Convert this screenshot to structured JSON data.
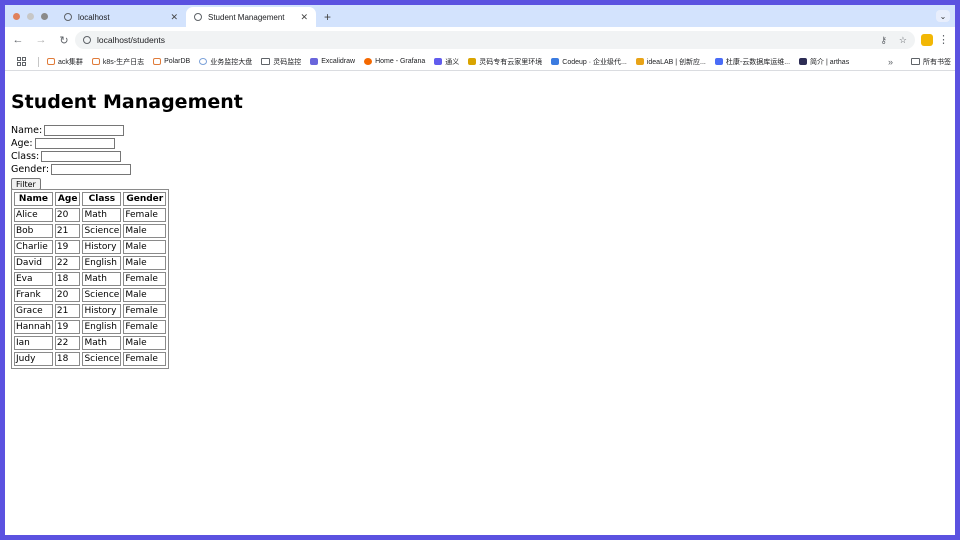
{
  "browser": {
    "tabs": [
      {
        "title": "localhost",
        "active": false
      },
      {
        "title": "Student Management",
        "active": true
      }
    ],
    "new_tab_glyph": "+",
    "url": "localhost/students",
    "bookmarks": [
      {
        "label": "ack集群",
        "icon": "bracket-icon"
      },
      {
        "label": "k8s-生产日志",
        "icon": "bracket-icon"
      },
      {
        "label": "PolarDB",
        "icon": "bracket-icon"
      },
      {
        "label": "业务监控大盘",
        "icon": "gear-icon"
      },
      {
        "label": "灵码监控",
        "icon": "folder-icon"
      },
      {
        "label": "Excalidraw",
        "icon": "tools-icon"
      },
      {
        "label": "Home - Grafana",
        "icon": "grafana-icon"
      },
      {
        "label": "通义",
        "icon": "tongyi-icon"
      },
      {
        "label": "灵码专有云家里环境",
        "icon": "lingma-icon"
      },
      {
        "label": "Codeup · 企业级代...",
        "icon": "codeup-icon"
      },
      {
        "label": "ideaLAB | 创新应...",
        "icon": "idealab-icon"
      },
      {
        "label": "杜康-云数据库运维...",
        "icon": "dukang-icon"
      },
      {
        "label": "简介 | arthas",
        "icon": "arthas-icon"
      }
    ],
    "bookmarks_overflow": "»",
    "all_bookmarks": "所有书签"
  },
  "page": {
    "title": "Student Management",
    "filters": [
      {
        "label": "Name:",
        "value": ""
      },
      {
        "label": "Age:",
        "value": ""
      },
      {
        "label": "Class:",
        "value": ""
      },
      {
        "label": "Gender:",
        "value": ""
      }
    ],
    "filter_button": "Filter",
    "table": {
      "headers": [
        "Name",
        "Age",
        "Class",
        "Gender"
      ],
      "rows": [
        [
          "Alice",
          "20",
          "Math",
          "Female"
        ],
        [
          "Bob",
          "21",
          "Science",
          "Male"
        ],
        [
          "Charlie",
          "19",
          "History",
          "Male"
        ],
        [
          "David",
          "22",
          "English",
          "Male"
        ],
        [
          "Eva",
          "18",
          "Math",
          "Female"
        ],
        [
          "Frank",
          "20",
          "Science",
          "Male"
        ],
        [
          "Grace",
          "21",
          "History",
          "Female"
        ],
        [
          "Hannah",
          "19",
          "English",
          "Female"
        ],
        [
          "Ian",
          "22",
          "Math",
          "Male"
        ],
        [
          "Judy",
          "18",
          "Science",
          "Female"
        ]
      ]
    }
  },
  "colors": {
    "frame": "#5b52e0",
    "tabstrip": "#d3e3fd",
    "traffic_close": "#e0815c",
    "traffic_min": "#c7c7c7",
    "traffic_max": "#8a8a8a"
  }
}
